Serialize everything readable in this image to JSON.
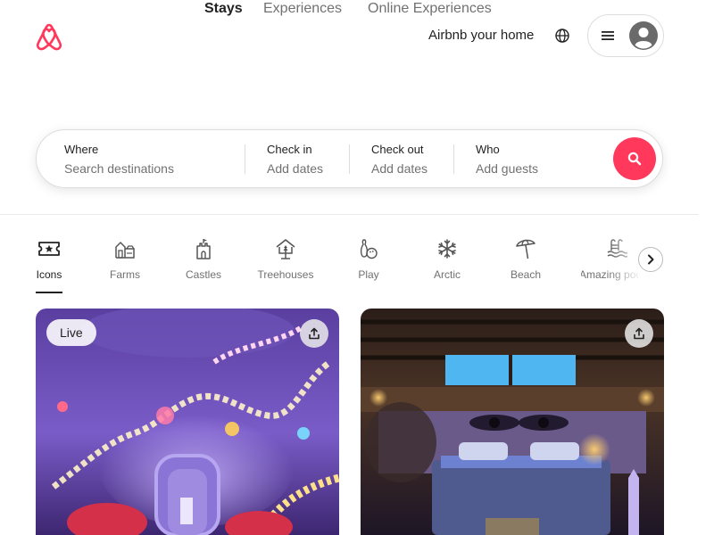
{
  "header": {
    "host_link": "Airbnb your home",
    "brand_color": "#ff385c"
  },
  "tabs": [
    {
      "label": "Stays",
      "active": true
    },
    {
      "label": "Experiences",
      "active": false
    },
    {
      "label": "Online Experiences",
      "active": false
    }
  ],
  "search": {
    "where": {
      "label": "Where",
      "placeholder": "Search destinations"
    },
    "checkin": {
      "label": "Check in",
      "value": "Add dates"
    },
    "checkout": {
      "label": "Check out",
      "value": "Add dates"
    },
    "who": {
      "label": "Who",
      "value": "Add guests"
    }
  },
  "categories": [
    {
      "label": "Icons",
      "icon": "ticket-star-icon",
      "active": true
    },
    {
      "label": "Farms",
      "icon": "barn-icon",
      "active": false
    },
    {
      "label": "Castles",
      "icon": "castle-icon",
      "active": false
    },
    {
      "label": "Treehouses",
      "icon": "treehouse-icon",
      "active": false
    },
    {
      "label": "Play",
      "icon": "bowling-icon",
      "active": false
    },
    {
      "label": "Arctic",
      "icon": "snowflake-icon",
      "active": false
    },
    {
      "label": "Beach",
      "icon": "umbrella-icon",
      "active": false
    },
    {
      "label": "Amazing pools",
      "icon": "pool-icon",
      "active": false
    }
  ],
  "listings": [
    {
      "badge": "Live",
      "scene": "purple neon playroom"
    },
    {
      "badge": "",
      "scene": "attic bedroom with eye mural"
    }
  ]
}
